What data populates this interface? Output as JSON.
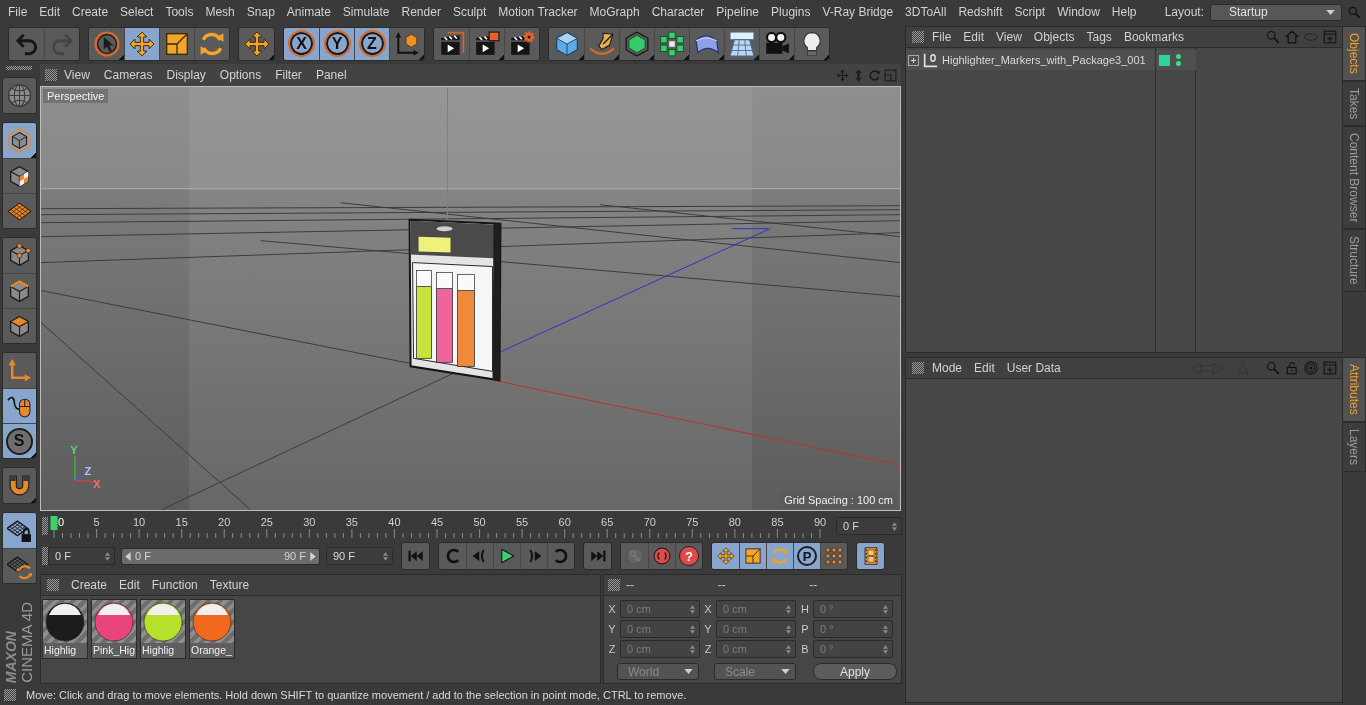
{
  "menu_bar": {
    "items": [
      "File",
      "Edit",
      "Create",
      "Select",
      "Tools",
      "Mesh",
      "Snap",
      "Animate",
      "Simulate",
      "Render",
      "Sculpt",
      "Motion Tracker",
      "MoGraph",
      "Character",
      "Pipeline",
      "Plugins",
      "V-Ray Bridge",
      "3DToAll",
      "Redshift",
      "Script",
      "Window",
      "Help"
    ],
    "layout_label": "Layout:",
    "layout_value": "Startup"
  },
  "toolbar": [
    {
      "items": [
        {
          "kind": "undo",
          "selected": false,
          "disabled": false,
          "submenu": false
        },
        {
          "kind": "redo",
          "selected": false,
          "disabled": true,
          "submenu": false
        }
      ]
    },
    {
      "items": [
        {
          "kind": "live-select",
          "selected": false,
          "submenu": true
        },
        {
          "kind": "move",
          "selected": true,
          "submenu": false
        },
        {
          "kind": "scale",
          "selected": false,
          "submenu": false
        },
        {
          "kind": "rotate",
          "selected": false,
          "submenu": false
        }
      ]
    },
    {
      "items": [
        {
          "kind": "move",
          "selected": false,
          "submenu": true
        }
      ]
    },
    {
      "items": [
        {
          "kind": "axis-letter",
          "label": "X",
          "selected": true,
          "submenu": false
        },
        {
          "kind": "axis-letter",
          "label": "Y",
          "selected": true,
          "submenu": false
        },
        {
          "kind": "axis-letter",
          "label": "Z",
          "selected": true,
          "submenu": false
        },
        {
          "kind": "axis-cube",
          "selected": false,
          "submenu": true
        }
      ]
    },
    {
      "items": [
        {
          "kind": "render-view",
          "selected": false,
          "submenu": false
        },
        {
          "kind": "render-viewer",
          "selected": false,
          "submenu": true
        },
        {
          "kind": "render-settings",
          "selected": false,
          "submenu": false
        }
      ]
    },
    {
      "items": [
        {
          "kind": "cube",
          "selected": false,
          "submenu": true
        },
        {
          "kind": "pen",
          "selected": false,
          "submenu": true
        },
        {
          "kind": "cage-cube",
          "selected": false,
          "submenu": true
        },
        {
          "kind": "cloner",
          "selected": false,
          "submenu": true
        },
        {
          "kind": "deformer",
          "selected": false,
          "submenu": true
        },
        {
          "kind": "sky-floor",
          "selected": false,
          "submenu": true
        },
        {
          "kind": "camera",
          "selected": false,
          "submenu": true
        },
        {
          "kind": "light",
          "selected": false,
          "submenu": true
        }
      ]
    }
  ],
  "left_toolbar": [
    {
      "items": [
        {
          "kind": "globe",
          "selected": false,
          "submenu": false
        }
      ]
    },
    {
      "items": [
        {
          "kind": "model-mode",
          "selected": true,
          "submenu": true
        },
        {
          "kind": "texture-mode",
          "selected": false,
          "submenu": false
        },
        {
          "kind": "workplane-mode",
          "selected": false,
          "submenu": false
        }
      ]
    },
    {
      "items": [
        {
          "kind": "points-mode",
          "selected": false,
          "submenu": false
        },
        {
          "kind": "edges-mode",
          "selected": false,
          "submenu": false
        },
        {
          "kind": "polygons-mode",
          "selected": false,
          "submenu": false
        }
      ]
    },
    {
      "items": [
        {
          "kind": "axis-mode",
          "selected": false,
          "submenu": false
        },
        {
          "kind": "tweak-mode",
          "selected": true,
          "submenu": false
        },
        {
          "kind": "solo-letter",
          "label": "S",
          "selected": true,
          "submenu": true
        }
      ]
    },
    {
      "items": [
        {
          "kind": "snap",
          "selected": false,
          "submenu": true
        }
      ]
    },
    {
      "items": [
        {
          "kind": "workplane-lock",
          "selected": true,
          "submenu": false
        },
        {
          "kind": "workplane-rotate",
          "selected": false,
          "submenu": false
        }
      ]
    }
  ],
  "logo": {
    "brand": "MAXON",
    "product": "CINEMA 4D"
  },
  "viewport": {
    "menu": [
      "View",
      "Cameras",
      "Display",
      "Options",
      "Filter",
      "Panel"
    ],
    "nav": [
      {
        "kind": "pan"
      },
      {
        "kind": "dolly"
      },
      {
        "kind": "orbit"
      },
      {
        "kind": "panel"
      }
    ],
    "camera_label": "Perspective",
    "gizmo_labels": [
      {
        "kind": "y",
        "label": "Y"
      },
      {
        "kind": "z",
        "label": "Z"
      },
      {
        "kind": "x",
        "label": "X"
      }
    ],
    "grid_spacing": "Grid Spacing : 100 cm"
  },
  "timeline": {
    "frames": [
      "0",
      "5",
      "10",
      "15",
      "20",
      "25",
      "30",
      "35",
      "40",
      "45",
      "50",
      "55",
      "60",
      "65",
      "70",
      "75",
      "80",
      "85",
      "90"
    ],
    "playhead": {
      "level": 0
    },
    "current_frame": "0 F"
  },
  "playback": {
    "start_field": "0 F",
    "range_start": "0 F",
    "range_end": "90 F",
    "range": {
      "level": 1
    },
    "end_field": "90 F",
    "groups": [
      {
        "items": [
          {
            "kind": "to-start"
          }
        ]
      },
      {
        "items": [
          {
            "kind": "prev-key"
          },
          {
            "kind": "prev-frame"
          },
          {
            "kind": "play"
          },
          {
            "kind": "next-frame"
          },
          {
            "kind": "next-key"
          }
        ]
      },
      {
        "items": [
          {
            "kind": "to-end"
          }
        ]
      },
      {
        "items": [
          {
            "kind": "key",
            "disabled": true
          },
          {
            "kind": "record",
            "disabled": false
          },
          {
            "kind": "alert-letter",
            "label": "?",
            "disabled": false
          }
        ]
      },
      {
        "items": [
          {
            "kind": "move",
            "selected": true
          },
          {
            "kind": "scale",
            "selected": true
          },
          {
            "kind": "rotate",
            "selected": true
          },
          {
            "kind": "param-letter",
            "label": "P",
            "selected": true
          },
          {
            "kind": "dot-grid",
            "selected": false
          }
        ]
      },
      {
        "items": [
          {
            "kind": "film-strip",
            "selected": true
          }
        ]
      }
    ]
  },
  "materials": {
    "menu": [
      "Create",
      "Edit",
      "Function",
      "Texture"
    ],
    "items": [
      {
        "name": "Highlig",
        "color": "#1c1c1c"
      },
      {
        "name": "Pink_Hig",
        "color": "#e8457c"
      },
      {
        "name": "Highlig",
        "color": "#b6e02c"
      },
      {
        "name": "Orange_",
        "color": "#f0691c"
      }
    ]
  },
  "coordinates": {
    "headers": [
      "--",
      "--",
      "--"
    ],
    "disabled": true,
    "rows": [
      {
        "position_axis": "X",
        "position": "0 cm",
        "size_axis": "X",
        "size": "0 cm",
        "rotation_axis": "H",
        "rotation": "0 °"
      },
      {
        "position_axis": "Y",
        "position": "0 cm",
        "size_axis": "Y",
        "size": "0 cm",
        "rotation_axis": "P",
        "rotation": "0 °"
      },
      {
        "position_axis": "Z",
        "position": "0 cm",
        "size_axis": "Z",
        "size": "0 cm",
        "rotation_axis": "B",
        "rotation": "0 °"
      }
    ],
    "coordinate_system": "World",
    "size_mode": "Scale",
    "apply": "Apply"
  },
  "status_bar": {
    "text": "Move: Click and drag to move elements. Hold down SHIFT to quantize movement / add to the selection in point mode, CTRL to remove."
  },
  "object_manager": {
    "menu": [
      "File",
      "Edit",
      "View",
      "Objects",
      "Tags",
      "Bookmarks"
    ],
    "tools": [
      {
        "kind": "search"
      },
      {
        "kind": "home"
      },
      {
        "kind": "oval"
      },
      {
        "kind": "new-panel"
      }
    ],
    "objects": [
      {
        "name": "Highlighter_Markers_with_Package3_001",
        "expanded": false,
        "color": "#2fd39a",
        "editor_visible": true,
        "render_visible": true
      }
    ]
  },
  "object_tabs": [
    {
      "label": "Objects",
      "selected": true
    },
    {
      "label": "Takes",
      "selected": false
    },
    {
      "label": "Content Browser",
      "selected": false
    },
    {
      "label": "Structure",
      "selected": false
    }
  ],
  "attributes": {
    "menu": [
      "Mode",
      "Edit",
      "User Data"
    ],
    "tools": [
      {
        "kind": "back-forward",
        "disabled": true
      },
      {
        "kind": "up",
        "disabled": true
      },
      {
        "kind": "search",
        "disabled": false
      },
      {
        "kind": "lock",
        "disabled": false
      },
      {
        "kind": "target",
        "disabled": false
      },
      {
        "kind": "new-panel",
        "disabled": false
      }
    ]
  },
  "attribute_tabs": [
    {
      "label": "Attributes",
      "selected": true
    },
    {
      "label": "Layers",
      "selected": false
    }
  ]
}
